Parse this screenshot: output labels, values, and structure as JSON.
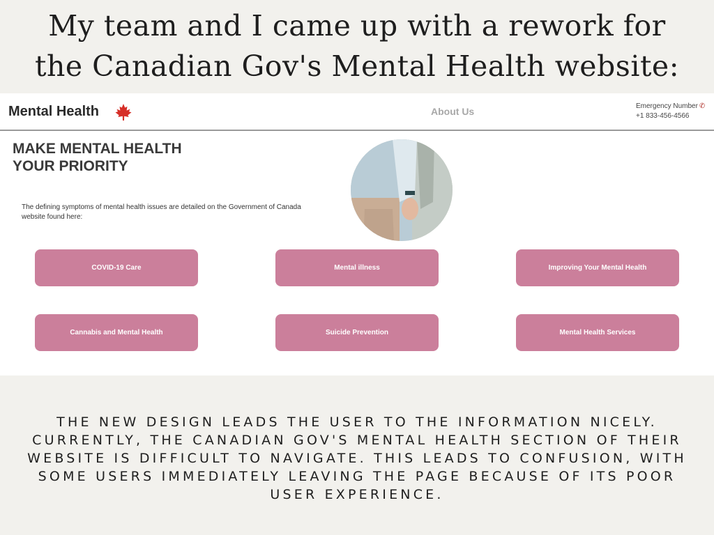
{
  "headline": {
    "line1": "My team and I came up with a rework for",
    "line2": "the Canadian Gov's Mental Health website:"
  },
  "mockup": {
    "nav": {
      "brand": "Mental Health",
      "brand_icon": "maple-leaf-icon",
      "about": "About Us",
      "emergency_label": "Emergency Number",
      "emergency_icon": "phone-icon",
      "emergency_number": "+1 833-456-4566"
    },
    "hero": {
      "title": "MAKE MENTAL HEALTH YOUR PRIORITY",
      "description": "The defining symptoms of mental health issues are detailed on the Government of Canada website found here:"
    },
    "buttons": [
      "COVID-19 Care",
      "Mental illness",
      "Improving Your Mental Health",
      "Cannabis and Mental Health",
      "Suicide Prevention",
      "Mental Health Services"
    ],
    "colors": {
      "button": "#cb7f9b",
      "leaf": "#d62e27",
      "background": "#f2f1ed"
    }
  },
  "caption": "THE NEW DESIGN LEADS THE USER TO THE INFORMATION NICELY. CURRENTLY, THE CANADIAN GOV'S MENTAL HEALTH SECTION OF THEIR WEBSITE IS DIFFICULT TO NAVIGATE. THIS LEADS TO CONFUSION, WITH SOME USERS IMMEDIATELY LEAVING THE PAGE BECAUSE OF ITS POOR USER EXPERIENCE."
}
